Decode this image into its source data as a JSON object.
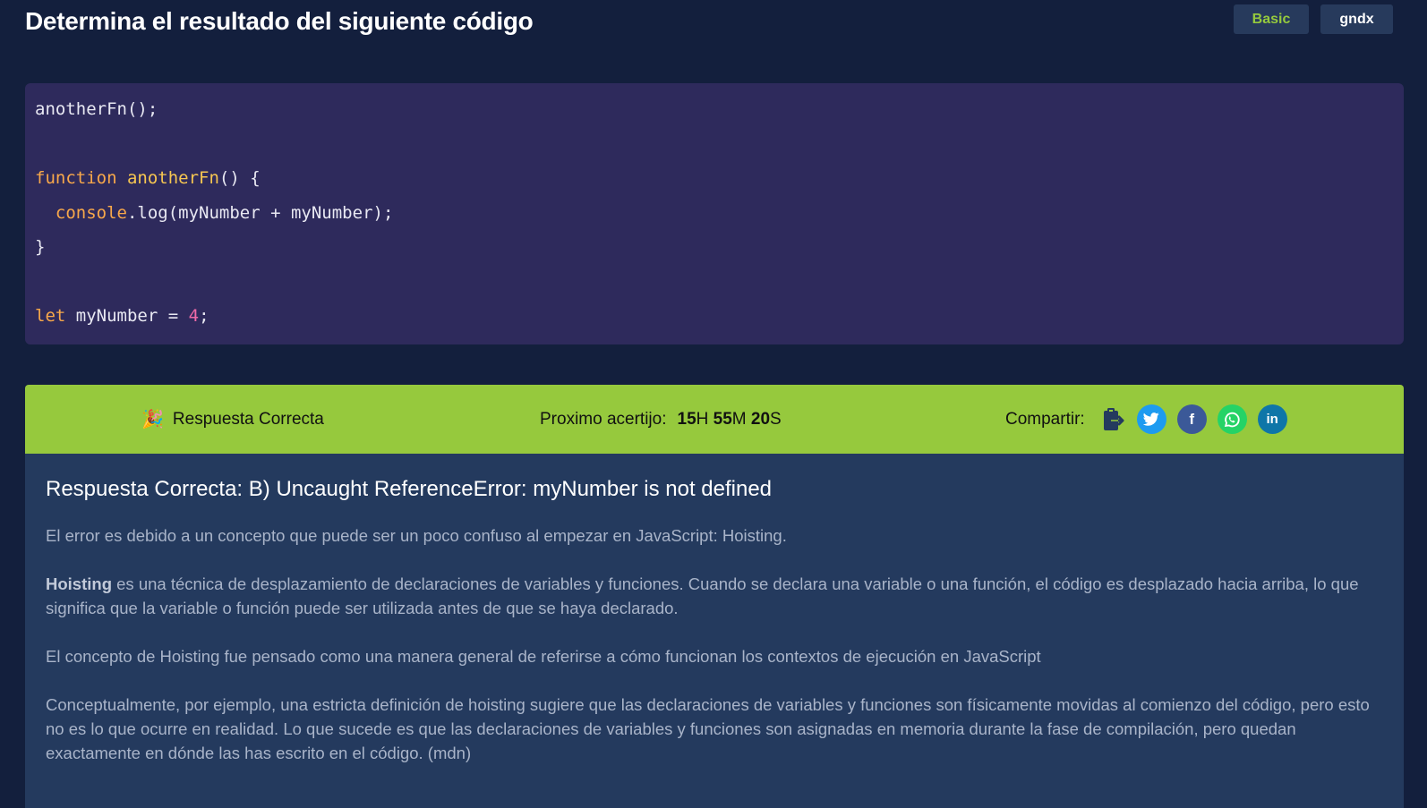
{
  "header": {
    "title": "Determina el resultado del siguiente código",
    "level_tag": "Basic",
    "author_tag": "gndx"
  },
  "code": {
    "line1": "anotherFn();",
    "fn_keyword": "function",
    "fn_name": "anotherFn",
    "fn_open": "() {",
    "obj": "console",
    "call": ".log(myNumber + myNumber);",
    "close": "}",
    "let_keyword": "let",
    "var_decl": " myNumber = ",
    "number": "4",
    "semicolon": ";"
  },
  "result": {
    "status_icon": "party-popper-icon",
    "status_text": "Respuesta Correcta",
    "next_label": "Proximo acertijo:",
    "hours": "15",
    "hours_unit": "H",
    "minutes": "55",
    "minutes_unit": "M",
    "seconds": "20",
    "seconds_unit": "S",
    "share_label": "Compartir:",
    "share_icons": [
      "clipboard-icon",
      "twitter-icon",
      "facebook-icon",
      "whatsapp-icon",
      "linkedin-icon"
    ],
    "twitter_glyph": "🐦",
    "facebook_glyph": "f",
    "whatsapp_glyph": "✆",
    "linkedin_glyph": "in"
  },
  "explanation": {
    "answer": "Respuesta Correcta: B) Uncaught ReferenceError: myNumber is not defined",
    "p1": "El error es debido a un concepto que puede ser un poco confuso al empezar en JavaScript: Hoisting.",
    "p2_bold": "Hoisting",
    "p2_rest": " es una técnica de desplazamiento de declaraciones de variables y funciones. Cuando se declara una variable o una función, el código es desplazado hacia arriba, lo que significa que la variable o función puede ser utilizada antes de que se haya declarado.",
    "p3": "El concepto de Hoisting fue pensado como una manera general de referirse a cómo funcionan los contextos de ejecución en JavaScript",
    "p4": "Conceptualmente, por ejemplo, una estricta definición de hoisting sugiere que las declaraciones de variables y funciones son físicamente movidas al comienzo del código, pero esto no es lo que ocurre en realidad. Lo que sucede es que las declaraciones de variables y funciones son asignadas en memoria durante la fase de compilación, pero quedan exactamente en dónde las has escrito en el código. (mdn)"
  },
  "colors": {
    "background": "#131f3d",
    "code_bg": "#2e2a5c",
    "success_green": "#96c93d",
    "panel_bg": "#243a5e"
  }
}
